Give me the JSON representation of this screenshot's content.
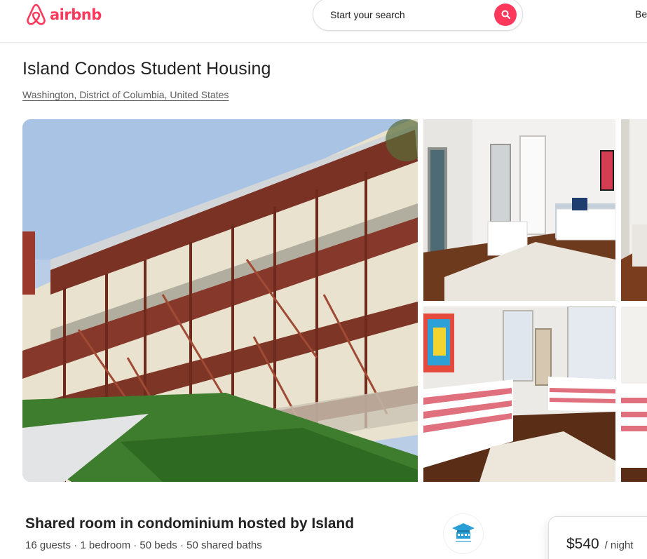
{
  "header": {
    "logo_text": "airbnb",
    "search_placeholder": "Start your search",
    "host_link_label": "Be"
  },
  "listing": {
    "title": "Island Condos Student Housing",
    "location": "Washington, District of Columbia, United States",
    "subtitle": "Shared room in condominium hosted by Island",
    "details": "16 guests · 1 bedroom · 50 beds · 50 shared baths"
  },
  "booking": {
    "price": "$540",
    "per_night": "/ night"
  },
  "icons": {
    "logo": "airbnb-belo-icon",
    "search": "search-icon"
  },
  "colors": {
    "brand": "#ff385c"
  }
}
